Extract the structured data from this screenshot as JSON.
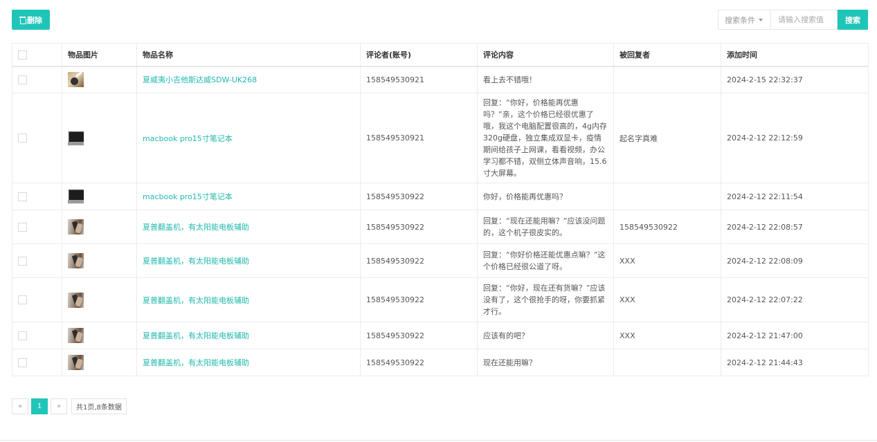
{
  "toolbar": {
    "delete_label": "删除",
    "search_condition_label": "搜索条件",
    "search_placeholder": "请输入搜索值",
    "search_button_label": "搜索"
  },
  "table": {
    "headers": [
      "物品图片",
      "物品名称",
      "评论者(账号)",
      "评论内容",
      "被回复者",
      "添加时间"
    ],
    "rows": [
      {
        "image": "guitar-thumbnail",
        "name": "夏威夷小吉他斯达威SDW-UK268",
        "commenter": "158549530921",
        "content": "看上去不错哦！",
        "reply_to": "",
        "time": "2024-2-15 22:32:37"
      },
      {
        "image": "laptop-thumbnail",
        "name": "macbook pro15寸笔记本",
        "commenter": "158549530921",
        "content": "回复：“你好，价格能再优惠吗？”亲，这个价格已经很优惠了哦，我这个电脑配置很高的，4g内存 320g硬盘，独立集成双显卡，疫情期间给孩子上网课，看看视频，办公学习都不错，双侧立体声音响，15.6寸大屏幕。",
        "reply_to": "起名字真难",
        "time": "2024-2-12 22:12:59"
      },
      {
        "image": "laptop-thumbnail",
        "name": "macbook pro15寸笔记本",
        "commenter": "158549530922",
        "content": "你好，价格能再优惠吗？",
        "reply_to": "",
        "time": "2024-2-12 22:11:54"
      },
      {
        "image": "phone-thumbnail",
        "name": "夏普翻盖机，有太阳能电板辅助",
        "commenter": "158549530922",
        "content": "回复：“现在还能用嘛？”应该没问题的，这个机子很皮实的。",
        "reply_to": "158549530922",
        "time": "2024-2-12 22:08:57"
      },
      {
        "image": "phone-thumbnail",
        "name": "夏普翻盖机，有太阳能电板辅助",
        "commenter": "158549530922",
        "content": "回复：“你好价格还能优惠点嘛？”这个价格已经很公道了呀。",
        "reply_to": "XXX",
        "time": "2024-2-12 22:08:09"
      },
      {
        "image": "phone-thumbnail",
        "name": "夏普翻盖机，有太阳能电板辅助",
        "commenter": "158549530922",
        "content": "回复：“你好，现在还有货嘛？”应该没有了，这个很抢手的呀，你要抓紧才行。",
        "reply_to": "XXX",
        "time": "2024-2-12 22:07:22"
      },
      {
        "image": "phone-thumbnail",
        "name": "夏普翻盖机，有太阳能电板辅助",
        "commenter": "158549530922",
        "content": "应该有的吧？",
        "reply_to": "XXX",
        "time": "2024-2-12 21:47:00"
      },
      {
        "image": "phone-thumbnail",
        "name": "夏普翻盖机，有太阳能电板辅助",
        "commenter": "158549530922",
        "content": "现在还能用嘛？",
        "reply_to": "",
        "time": "2024-2-12 21:44:43"
      }
    ]
  },
  "pagination": {
    "prev_label": "«",
    "current_page": "1",
    "next_label": "»",
    "summary": "共1页,8条数据"
  },
  "colors": {
    "accent": "#20c5b9",
    "link": "#20b9ad",
    "time": "#3bb24d"
  }
}
